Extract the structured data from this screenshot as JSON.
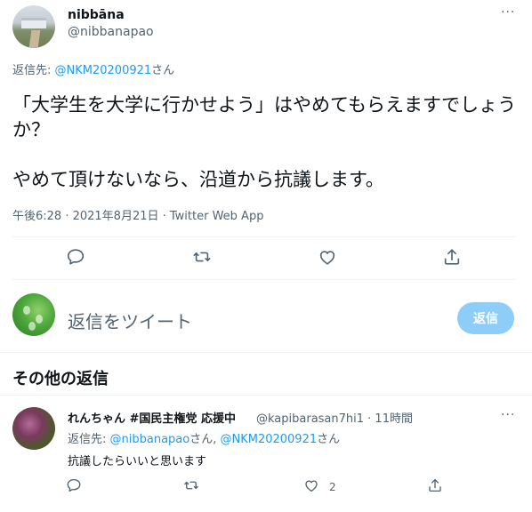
{
  "tweet": {
    "display_name": "nibbāna",
    "handle": "@nibbanapao",
    "more": "···",
    "reply_to_prefix": "返信先: ",
    "reply_to_mention": "@NKM20200921",
    "reply_to_suffix": "さん",
    "body": "「大学生を大学に行かせよう」はやめてもらえますでしょうか？\n\nやめて頂けないなら、沿道から抗議します。",
    "meta": "午後6:28 · 2021年8月21日 · Twitter Web App"
  },
  "actions": {
    "reply_icon": "reply-icon",
    "retweet_icon": "retweet-icon",
    "like_icon": "heart-icon",
    "share_icon": "share-icon"
  },
  "compose": {
    "placeholder": "返信をツイート",
    "button_label": "返信"
  },
  "replies_section": {
    "title": "その他の返信"
  },
  "reply": {
    "display_name": "れんちゃん #国民主権党 応援中",
    "handle_time": "@kapibarasan7hi1 · 11時間",
    "more": "···",
    "reply_to_prefix": "返信先: ",
    "reply_to_mention1": "@nibbanapao",
    "reply_to_mid": "さん, ",
    "reply_to_mention2": "@NKM20200921",
    "reply_to_suffix": "さん",
    "text": "抗議したらいいと思います",
    "like_count": "2"
  },
  "colors": {
    "accent": "#1d9bf0",
    "muted": "#536471",
    "reply_button_disabled": "#8ecdf8"
  }
}
